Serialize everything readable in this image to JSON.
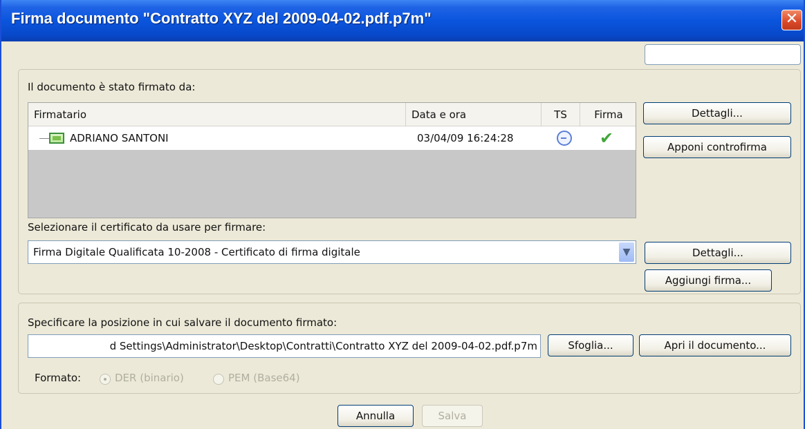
{
  "window": {
    "title": "Firma documento \"Contratto XYZ del 2009-04-02.pdf.p7m\"",
    "close_label": "✕"
  },
  "signers": {
    "label": "Il documento è stato firmato da:",
    "columns": [
      "Firmatario",
      "Data e ora",
      "TS",
      "Firma"
    ],
    "rows": [
      {
        "firmatario": "ADRIANO SANTONI",
        "data_ora": "03/04/09 16:24:28",
        "ts": "timestamp-icon",
        "firma": "valid-check-icon"
      }
    ],
    "dettagli_label": "Dettagli...",
    "controfirma_label": "Apponi controfirma"
  },
  "certificate": {
    "label": "Selezionare il certificato da usare per firmare:",
    "selected": "Firma Digitale Qualificata 10-2008 - Certificato di firma digitale",
    "dettagli_label": "Dettagli...",
    "aggiungi_label": "Aggiungi firma..."
  },
  "save": {
    "label": "Specificare la posizione in cui salvare il documento firmato:",
    "path": "d Settings\\Administrator\\Desktop\\Contratti\\Contratto XYZ del 2009-04-02.pdf.p7m",
    "sfoglia_label": "Sfoglia...",
    "apri_label": "Apri il documento...",
    "formato_label": "Formato:",
    "options": [
      "DER (binario)",
      "PEM (Base64)"
    ]
  },
  "footer": {
    "annulla_label": "Annulla",
    "salva_label": "Salva"
  },
  "colors": {
    "titlebar": "#0a55de",
    "dialog_bg": "#ece9d8",
    "check": "#41a63a"
  }
}
